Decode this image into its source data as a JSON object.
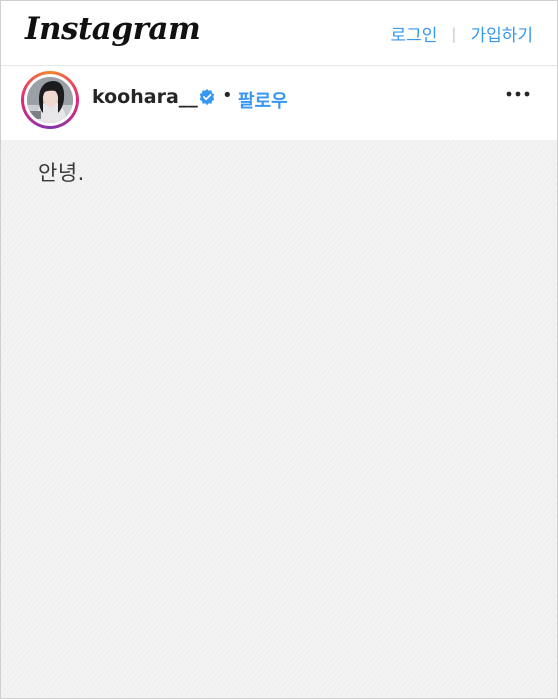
{
  "topbar": {
    "logo": "Instagram",
    "login_label": "로그인",
    "separator": "|",
    "signup_label": "가입하기",
    "link_color": "#3897f0"
  },
  "post": {
    "username": "koohara__",
    "verified_icon": "verified-badge-icon",
    "dot": "•",
    "follow_label": "팔로우",
    "more_icon": "more-options-icon",
    "body_text": "안녕."
  }
}
